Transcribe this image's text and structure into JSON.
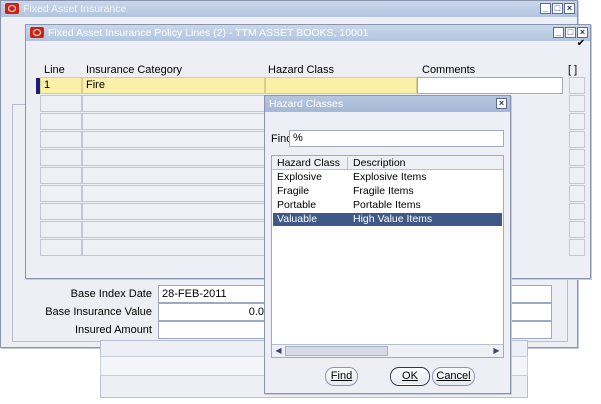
{
  "main_window": {
    "title": "Fixed Asset Insurance"
  },
  "policy_window": {
    "title": "Fixed Asset Insurance Policy Lines (2) - TTM ASSET BOOKS, 10001",
    "columns": {
      "line": "Line",
      "category": "Insurance Category",
      "hazard": "Hazard Class",
      "comments": "Comments",
      "bracket": "[ ]"
    },
    "rows": [
      {
        "line": "1",
        "category": "Fire",
        "hazard": "",
        "comments": ""
      }
    ],
    "checkbox_mark": "✔"
  },
  "lower_form": {
    "base_index_date_label": "Base Index Date",
    "base_index_date_value": "28-FEB-2011",
    "base_insurance_value_label": "Base Insurance Value",
    "base_insurance_value_value": "0.0",
    "insured_amount_label": "Insured Amount",
    "insured_amount_value": ""
  },
  "lov_dialog": {
    "title": "Hazard Classes",
    "find_label": "Find",
    "find_value": "%",
    "col_hazard": "Hazard Class",
    "col_description": "Description",
    "items": [
      {
        "class": "Explosive",
        "description": "Explosive Items",
        "selected": false
      },
      {
        "class": "Fragile",
        "description": "Fragile Items",
        "selected": false
      },
      {
        "class": "Portable",
        "description": "Portable Items",
        "selected": false
      },
      {
        "class": "Valuable",
        "description": "High Value Items",
        "selected": true
      }
    ],
    "find_button": "Find",
    "ok_button": "OK",
    "cancel_button": "Cancel"
  },
  "colors": {
    "selection": "#3f5887",
    "current_row": "#fbf0a8",
    "oracle_red": "#d31f0f"
  }
}
